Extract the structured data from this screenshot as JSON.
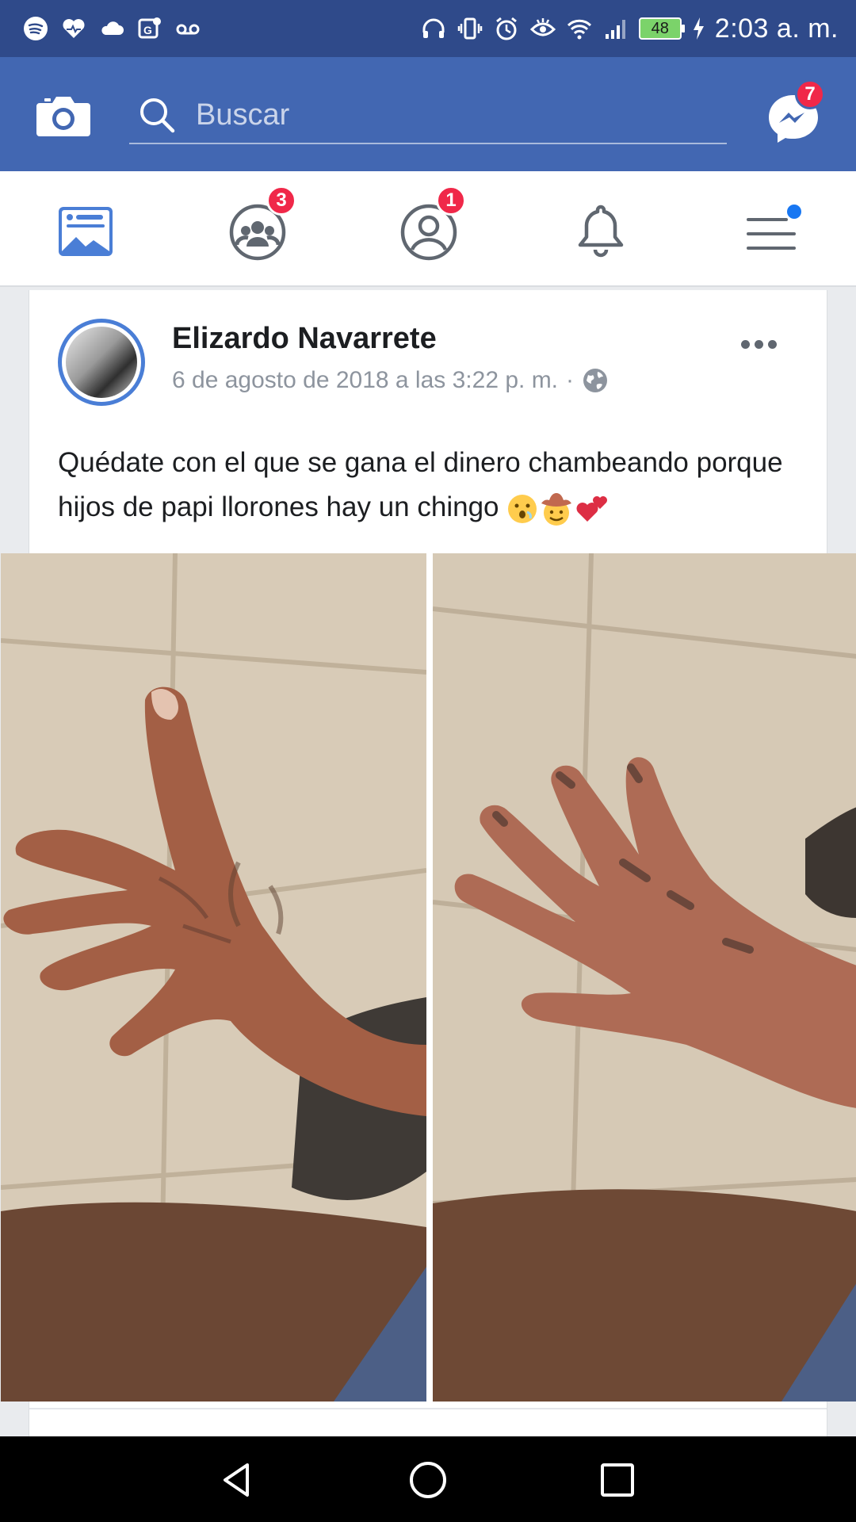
{
  "status_bar": {
    "battery": "48",
    "time": "2:03 a. m."
  },
  "app_bar": {
    "search_placeholder": "Buscar",
    "messenger_badge": "7"
  },
  "tabs": [
    {
      "name": "news-feed",
      "badge": ""
    },
    {
      "name": "groups",
      "badge": "3"
    },
    {
      "name": "friend-requests",
      "badge": "1"
    },
    {
      "name": "notifications",
      "badge": ""
    },
    {
      "name": "menu",
      "badge": ""
    }
  ],
  "post": {
    "author": "Elizardo Navarrete",
    "timestamp": "6 de agosto de 2018 a las 3:22 p. m.",
    "separator": "·",
    "text": "Quédate con el que se gana el dinero chambeando porque hijos de papi llorones hay un chingo",
    "emojis": [
      "hushed-face",
      "cowboy-face",
      "two-hearts"
    ]
  },
  "colors": {
    "status_bar": "#2f4a8a",
    "app_bar": "#4267b2",
    "accent": "#4a7ed6",
    "badge": "#f02849"
  }
}
